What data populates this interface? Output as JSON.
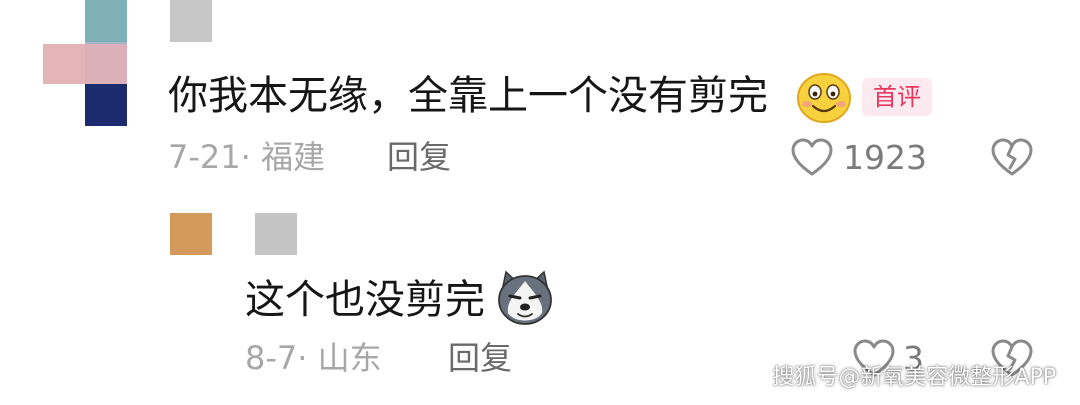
{
  "comments": [
    {
      "text": "你我本无缘，全靠上一个没有剪完",
      "emoji_icon": "smile-emoji-icon",
      "badge": "首评",
      "date_location": "7-21· 福建",
      "reply_label": "回复",
      "like_count": "1923"
    },
    {
      "text": "这个也没剪完",
      "emoji_icon": "husky-dog-emoji-icon",
      "date_location": "8-7· 山东",
      "reply_label": "回复",
      "like_count": "3"
    }
  ],
  "watermark": "搜狐号@新氧美容微整形APP",
  "colors": {
    "text": "#161616",
    "meta": "#a7a7a7",
    "badge_text": "#e8375e",
    "badge_bg": "#fdeaf0",
    "icon": "#8a8a8a"
  }
}
